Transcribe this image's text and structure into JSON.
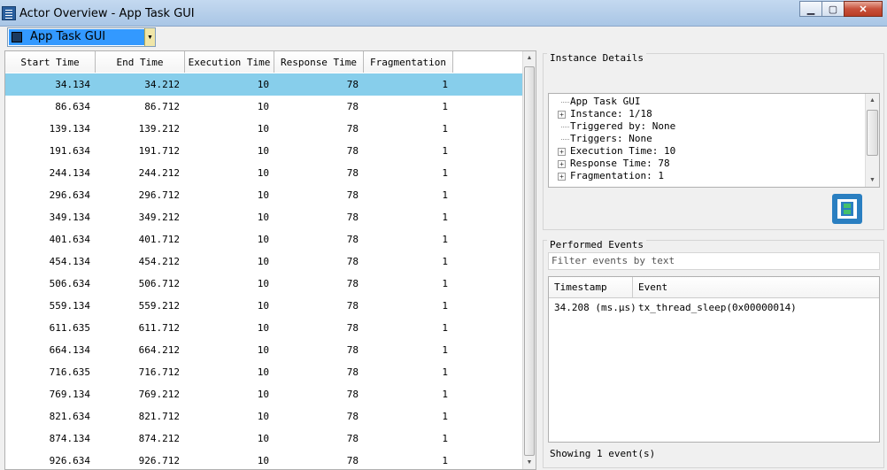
{
  "window": {
    "title": "Actor Overview - App Task GUI",
    "buttons": {
      "minimize": "▁",
      "maximize": "▢",
      "close": "✕"
    }
  },
  "actor_select": {
    "value": "App Task GUI"
  },
  "instances_table": {
    "columns": [
      "Start Time",
      "End Time",
      "Execution Time",
      "Response Time",
      "Fragmentation"
    ],
    "rows": [
      [
        "34.134",
        "34.212",
        "10",
        "78",
        "1"
      ],
      [
        "86.634",
        "86.712",
        "10",
        "78",
        "1"
      ],
      [
        "139.134",
        "139.212",
        "10",
        "78",
        "1"
      ],
      [
        "191.634",
        "191.712",
        "10",
        "78",
        "1"
      ],
      [
        "244.134",
        "244.212",
        "10",
        "78",
        "1"
      ],
      [
        "296.634",
        "296.712",
        "10",
        "78",
        "1"
      ],
      [
        "349.134",
        "349.212",
        "10",
        "78",
        "1"
      ],
      [
        "401.634",
        "401.712",
        "10",
        "78",
        "1"
      ],
      [
        "454.134",
        "454.212",
        "10",
        "78",
        "1"
      ],
      [
        "506.634",
        "506.712",
        "10",
        "78",
        "1"
      ],
      [
        "559.134",
        "559.212",
        "10",
        "78",
        "1"
      ],
      [
        "611.635",
        "611.712",
        "10",
        "78",
        "1"
      ],
      [
        "664.134",
        "664.212",
        "10",
        "78",
        "1"
      ],
      [
        "716.635",
        "716.712",
        "10",
        "78",
        "1"
      ],
      [
        "769.134",
        "769.212",
        "10",
        "78",
        "1"
      ],
      [
        "821.634",
        "821.712",
        "10",
        "78",
        "1"
      ],
      [
        "874.134",
        "874.212",
        "10",
        "78",
        "1"
      ],
      [
        "926.634",
        "926.712",
        "10",
        "78",
        "1"
      ]
    ],
    "selected_row": 0
  },
  "instance_details": {
    "title": "Instance Details",
    "tree": [
      {
        "text": "App Task GUI",
        "expandable": false
      },
      {
        "text": "Instance: 1/18",
        "expandable": true
      },
      {
        "text": "Triggered by: None",
        "expandable": false
      },
      {
        "text": "Triggers: None",
        "expandable": false
      },
      {
        "text": "Execution Time: 10",
        "expandable": true
      },
      {
        "text": "Response Time: 78",
        "expandable": true
      },
      {
        "text": "Fragmentation: 1",
        "expandable": true
      }
    ]
  },
  "performed_events": {
    "title": "Performed Events",
    "filter_placeholder": "Filter events by text",
    "columns": [
      "Timestamp",
      "Event"
    ],
    "rows": [
      [
        "34.208 (ms.µs)",
        "tx_thread_sleep(0x00000014)"
      ]
    ],
    "status": "Showing 1 event(s)"
  },
  "icons": {
    "app_icon": "list-window-icon",
    "logo": "tracealyzer-logo-icon",
    "expander": "plus-expander-icon"
  },
  "colors": {
    "selected_row": "#87ceeb",
    "combo_highlight": "#3399ff"
  }
}
